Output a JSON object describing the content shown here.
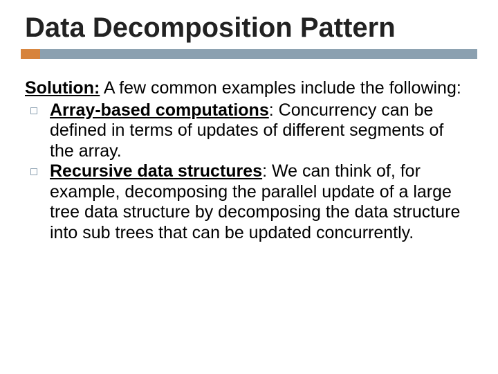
{
  "title": "Data Decomposition Pattern",
  "intro": {
    "label": "Solution:",
    "text": " A few common examples include the following:"
  },
  "bullets": [
    {
      "title": "Array-based computations",
      "text": ": Concurrency can be defined in terms of updates of different segments of the array."
    },
    {
      "title": "Recursive data structures",
      "text": ": We can think of, for example, decomposing the parallel update of a large tree data structure by decomposing the data structure into sub trees that can be updated concurrently."
    }
  ]
}
